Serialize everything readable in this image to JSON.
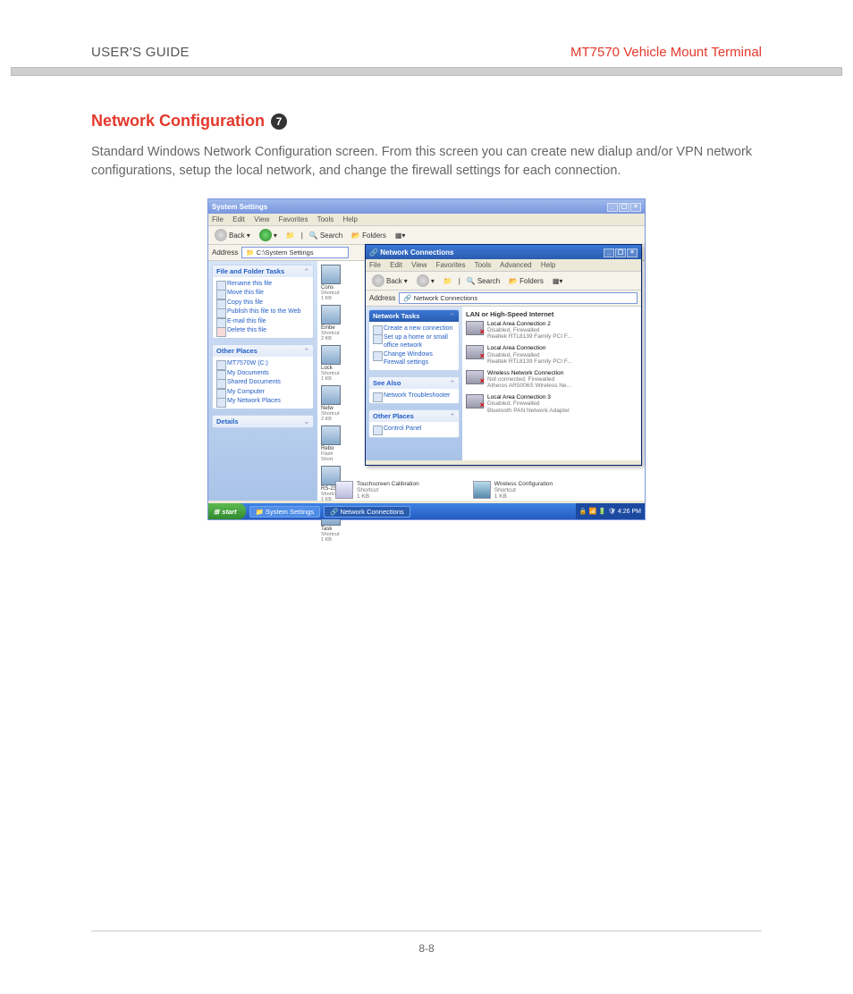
{
  "header": {
    "left": "USER'S GUIDE",
    "right": "MT7570 Vehicle Mount Terminal"
  },
  "section": {
    "title": "Network Configuration",
    "badge": "7"
  },
  "body": "Standard Windows Network Configuration screen.  From this screen you can create new dialup and/or VPN network configurations, setup the local network, and change the firewall settings for each connection.",
  "footer": "8-8",
  "outer": {
    "title": "System Settings",
    "menu": [
      "File",
      "Edit",
      "View",
      "Favorites",
      "Tools",
      "Help"
    ],
    "toolbar": {
      "back": "Back",
      "search": "Search",
      "folders": "Folders"
    },
    "address_label": "Address",
    "address_value": "C:\\System Settings",
    "panels": {
      "tasks": {
        "title": "File and Folder Tasks",
        "items": [
          "Rename this file",
          "Move this file",
          "Copy this file",
          "Publish this file to the Web",
          "E-mail this file",
          "Delete this file"
        ]
      },
      "other": {
        "title": "Other Places",
        "items": [
          "MT7570W (C:)",
          "My Documents",
          "Shared Documents",
          "My Computer",
          "My Network Places"
        ]
      },
      "details": {
        "title": "Details"
      }
    },
    "icons": [
      {
        "name": "Cons",
        "sub": "Shortcut",
        "size": "1 KB"
      },
      {
        "name": "Embe",
        "sub": "Shortcut",
        "size": "2 KB"
      },
      {
        "name": "Lock",
        "sub": "Shortcut",
        "size": "1 KB"
      },
      {
        "name": "Netw",
        "sub": "Shortcut",
        "size": "2 KB"
      },
      {
        "name": "Rebo",
        "sub": "Flash",
        "size": "Short"
      },
      {
        "name": "RS-23",
        "sub": "Shortcut",
        "size": "1 KB"
      },
      {
        "name": "Task",
        "sub": "Shortcut",
        "size": "1 KB"
      }
    ],
    "bottom_items": [
      {
        "name": "Touchscreen Calibration",
        "sub": "Shortcut",
        "size": "1 KB"
      },
      {
        "name": "Wireless Configuration",
        "sub": "Shortcut",
        "size": "1 KB"
      }
    ]
  },
  "inner": {
    "title": "Network Connections",
    "menu": [
      "File",
      "Edit",
      "View",
      "Favorites",
      "Tools",
      "Advanced",
      "Help"
    ],
    "toolbar": {
      "back": "Back",
      "search": "Search",
      "folders": "Folders"
    },
    "address_label": "Address",
    "address_value": "Network Connections",
    "panels": {
      "tasks": {
        "title": "Network Tasks",
        "items": [
          "Create a new connection",
          "Set up a home or small office network",
          "Change Windows Firewall settings"
        ]
      },
      "see": {
        "title": "See Also",
        "items": [
          "Network Troubleshooter"
        ]
      },
      "other": {
        "title": "Other Places",
        "items": [
          "Control Panel"
        ]
      }
    },
    "category": "LAN or High-Speed Internet",
    "nics": [
      {
        "name": "Local Area Connection 2",
        "status": "Disabled, Firewalled",
        "detail": "Realtek RTL8139 Family PCI F...",
        "dis": true
      },
      {
        "name": "Local Area Connection",
        "status": "Disabled, Firewalled",
        "detail": "Realtek RTL8139 Family PCI F...",
        "dis": true
      },
      {
        "name": "Wireless Network Connection",
        "status": "Not connected, Firewalled",
        "detail": "Atheros AR5006S Wireless Ne...",
        "dis": true
      },
      {
        "name": "Local Area Connection 3",
        "status": "Disabled, Firewalled",
        "detail": "Bluetooth PAN Network Adapter",
        "dis": true
      }
    ]
  },
  "taskbar": {
    "start": "start",
    "tabs": [
      "System Settings",
      "Network Connections"
    ],
    "time": "4:26 PM"
  }
}
